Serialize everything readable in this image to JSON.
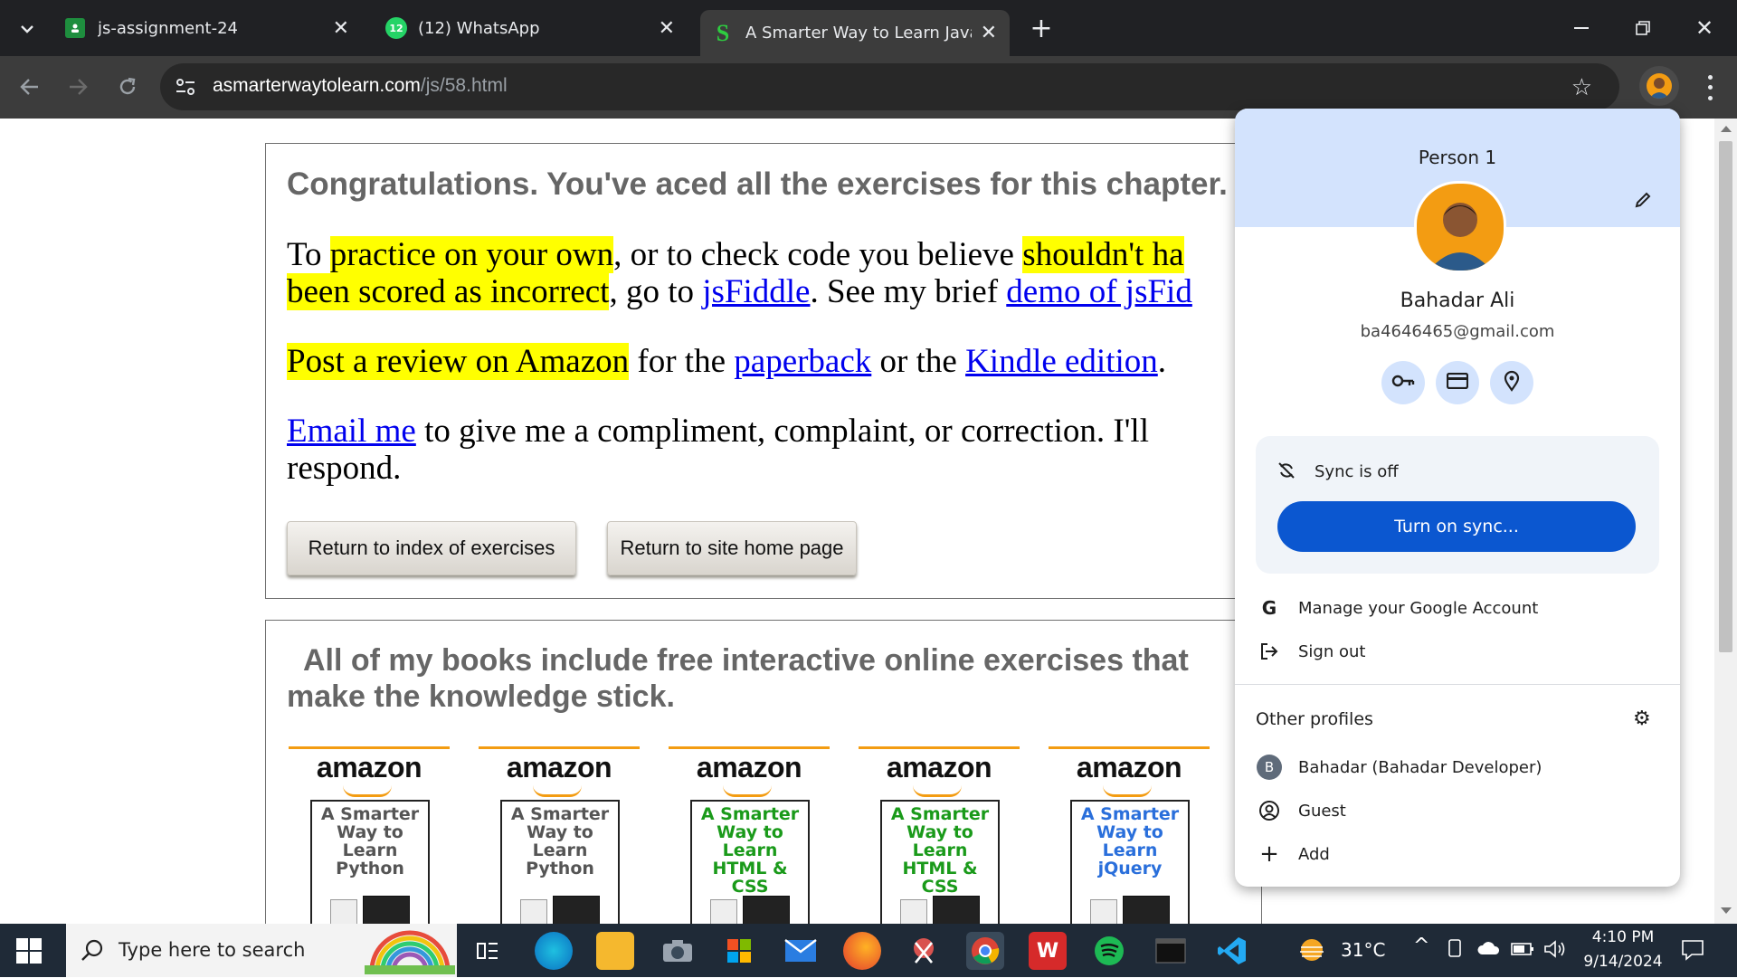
{
  "tabs": [
    {
      "title": "js-assignment-24",
      "icon": "google-classroom-icon",
      "active": false
    },
    {
      "title": "(12) WhatsApp",
      "icon": "whatsapp-icon",
      "badge": "12",
      "active": false
    },
    {
      "title": "A Smarter Way to Learn JavaScr",
      "icon": "smarter-way-icon",
      "active": true
    }
  ],
  "address": {
    "domain": "asmarterwaytolearn.com",
    "path": "/js/58.html"
  },
  "page": {
    "congrats": "Congratulations. You've aced all the exercises for this chapter.",
    "p1_a": "To ",
    "p1_hl1": "practice on your own",
    "p1_b": ", or to check code you believe ",
    "p1_hl2": "shouldn't ha",
    "p1_hl3": "been scored as incorrect",
    "p1_c": ", go to ",
    "p1_link1": "jsFiddle",
    "p1_d": ". See my brief ",
    "p1_link2": "demo of jsFid",
    "p2_hl": "Post a review on Amazon",
    "p2_a": " for the ",
    "p2_link1": "paperback",
    "p2_b": " or the ",
    "p2_link2": "Kindle edition",
    "p2_c": ".",
    "p3_link": "Email me",
    "p3_a": " to give me a compliment, complaint, or correction. I'll respond.",
    "btn_index": "Return to index of exercises",
    "btn_home": "Return to site home page",
    "books_heading": "All of my books include free interactive online exercises that make the knowledge stick.",
    "books": [
      {
        "brand": "amazon",
        "title": "A Smarter Way to Learn Python",
        "color": "#555555"
      },
      {
        "brand": "amazon",
        "title": "A Smarter Way to Learn Python",
        "color": "#555555"
      },
      {
        "brand": "amazon",
        "title": "A Smarter Way to Learn HTML & CSS",
        "color": "#1a9a1a"
      },
      {
        "brand": "amazon",
        "title": "A Smarter Way to Learn HTML & CSS",
        "color": "#1a9a1a"
      },
      {
        "brand": "amazon",
        "title": "A Smarter Way to Learn jQuery",
        "color": "#2a6fdb"
      }
    ]
  },
  "profile": {
    "label": "Person 1",
    "name": "Bahadar Ali",
    "email": "ba4646465@gmail.com",
    "sync_status": "Sync is off",
    "sync_button": "Turn on sync...",
    "manage": "Manage your Google Account",
    "signout": "Sign out",
    "other_profiles": "Other profiles",
    "profiles": [
      {
        "name": "Bahadar (Bahadar Developer)",
        "initial": "B"
      },
      {
        "name": "Guest"
      },
      {
        "name": "Add"
      }
    ]
  },
  "taskbar": {
    "search_placeholder": "Type here to search",
    "temperature": "31°C",
    "time": "4:10 PM",
    "date": "9/14/2024"
  }
}
